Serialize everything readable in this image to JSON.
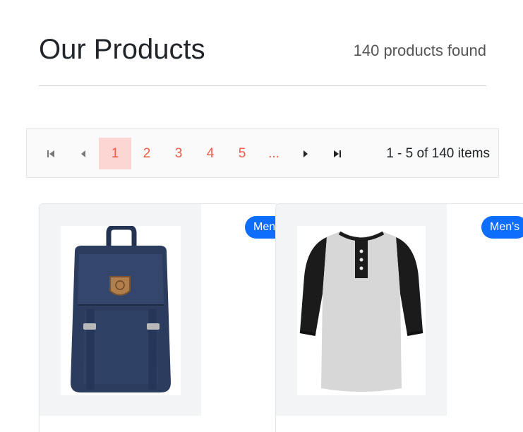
{
  "header": {
    "title": "Our Products",
    "count_text": "140 products found"
  },
  "pager": {
    "pages": [
      "1",
      "2",
      "3",
      "4",
      "5",
      "..."
    ],
    "info": "1 - 5 of 140 items"
  },
  "products": [
    {
      "badge": "Men's",
      "image": "backpack-icon"
    },
    {
      "badge": "Men's",
      "image": "raglan-shirt-icon"
    }
  ]
}
